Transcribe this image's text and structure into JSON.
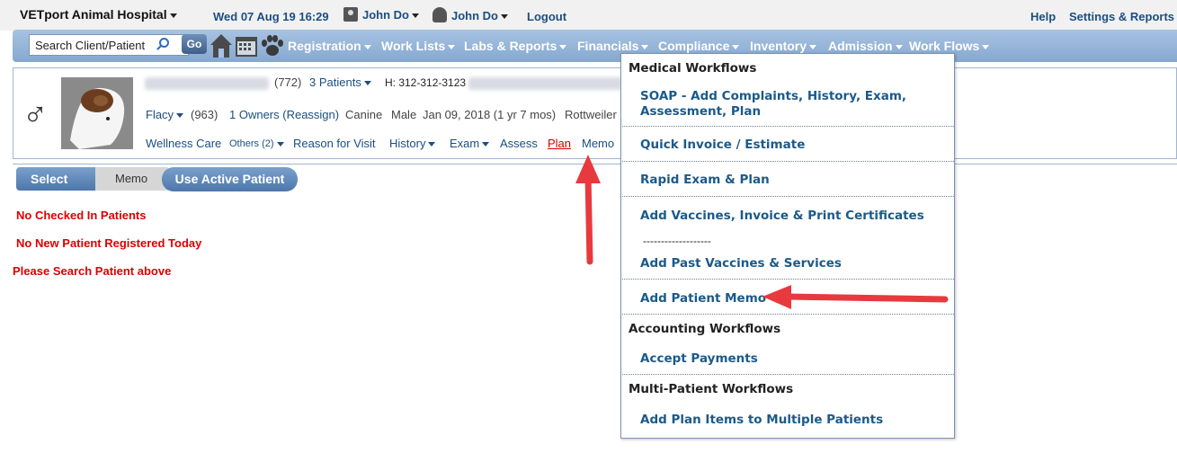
{
  "topbar": {
    "hospital": "VETport Animal Hospital",
    "datetime": "Wed 07 Aug 19 16:29",
    "user1": "John Do",
    "user2": "John Do",
    "logout": "Logout",
    "help": "Help",
    "settings": "Settings & Reports"
  },
  "navbar": {
    "search_value": "Search Client/Patient",
    "go": "Go",
    "items": [
      "Registration",
      "Work Lists",
      "Labs & Reports",
      "Financials",
      "Compliance",
      "Inventory",
      "Admission",
      "Work Flows"
    ]
  },
  "patient": {
    "client_count": "(772)",
    "patients": "3 Patients",
    "phone": "H: 312-312-3123",
    "name": "Flacy",
    "patient_id": "(963)",
    "owners": "1 Owners (Reassign)",
    "species": "Canine",
    "sex": "Male",
    "dob": "Jan 09, 2018 (1 yr 7 mos)",
    "breed": "Rottweiler",
    "tabs": {
      "wellness": "Wellness Care",
      "others": "Others (2)",
      "reason": "Reason for Visit",
      "history": "History",
      "exam": "Exam",
      "assess": "Assess",
      "plan": "Plan",
      "memo": "Memo"
    }
  },
  "breadcrumb": {
    "select": "Select",
    "memo": "Memo",
    "use_active": "Use Active Patient"
  },
  "messages": {
    "no_checked_in": "No Checked In Patients",
    "no_new": "No New Patient Registered Today",
    "search_above": "Please Search Patient above"
  },
  "menu": {
    "medical_head": "Medical Workflows",
    "soap_line1": "SOAP - Add Complaints, History, Exam,",
    "soap_line2": "Assessment, Plan",
    "quick_invoice": "Quick Invoice / Estimate",
    "rapid_exam": "Rapid Exam & Plan",
    "add_vaccines": "Add Vaccines, Invoice & Print Certificates",
    "dashes": "-------------------",
    "past_vaccines": "Add Past Vaccines & Services",
    "patient_memo": "Add Patient Memo",
    "accounting_head": "Accounting Workflows",
    "accept_payments": "Accept Payments",
    "multi_head": "Multi-Patient Workflows",
    "plan_items": "Add Plan Items to Multiple Patients"
  },
  "colors": {
    "nav_blue": "#86a8d0",
    "link_blue": "#1b4e80",
    "alert_red": "#dd0000",
    "arrow_red": "#e8393e"
  },
  "icons": [
    "male-icon",
    "home-icon",
    "calendar-icon",
    "paw-icon",
    "search-icon",
    "user-icon",
    "badge-icon",
    "up-arrow-annotation",
    "left-arrow-annotation"
  ]
}
